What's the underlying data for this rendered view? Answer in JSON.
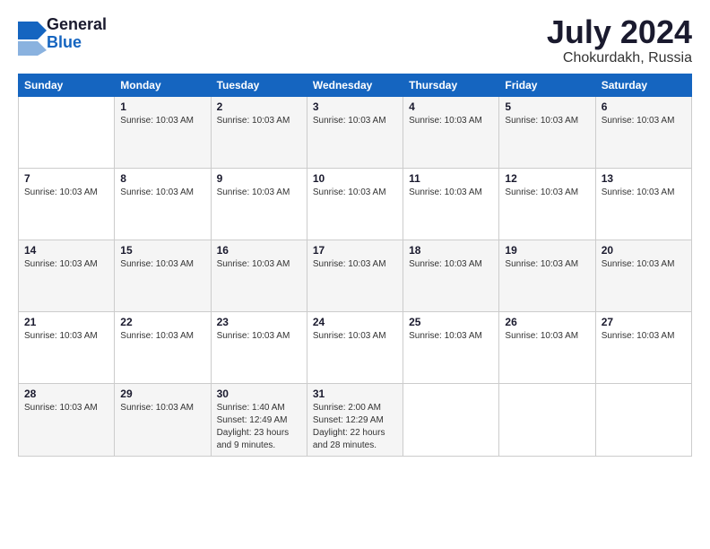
{
  "header": {
    "logo_general": "General",
    "logo_blue": "Blue",
    "month_title": "July 2024",
    "location": "Chokurdakh, Russia"
  },
  "calendar": {
    "days_of_week": [
      "Sunday",
      "Monday",
      "Tuesday",
      "Wednesday",
      "Thursday",
      "Friday",
      "Saturday"
    ],
    "weeks": [
      [
        {
          "day": "",
          "info": ""
        },
        {
          "day": "1",
          "info": "Sunrise: 10:03 AM"
        },
        {
          "day": "2",
          "info": "Sunrise: 10:03 AM"
        },
        {
          "day": "3",
          "info": "Sunrise: 10:03 AM"
        },
        {
          "day": "4",
          "info": "Sunrise: 10:03 AM"
        },
        {
          "day": "5",
          "info": "Sunrise: 10:03 AM"
        },
        {
          "day": "6",
          "info": "Sunrise: 10:03 AM"
        }
      ],
      [
        {
          "day": "7",
          "info": "Sunrise: 10:03 AM"
        },
        {
          "day": "8",
          "info": "Sunrise: 10:03 AM"
        },
        {
          "day": "9",
          "info": "Sunrise: 10:03 AM"
        },
        {
          "day": "10",
          "info": "Sunrise: 10:03 AM"
        },
        {
          "day": "11",
          "info": "Sunrise: 10:03 AM"
        },
        {
          "day": "12",
          "info": "Sunrise: 10:03 AM"
        },
        {
          "day": "13",
          "info": "Sunrise: 10:03 AM"
        }
      ],
      [
        {
          "day": "14",
          "info": "Sunrise: 10:03 AM"
        },
        {
          "day": "15",
          "info": "Sunrise: 10:03 AM"
        },
        {
          "day": "16",
          "info": "Sunrise: 10:03 AM"
        },
        {
          "day": "17",
          "info": "Sunrise: 10:03 AM"
        },
        {
          "day": "18",
          "info": "Sunrise: 10:03 AM"
        },
        {
          "day": "19",
          "info": "Sunrise: 10:03 AM"
        },
        {
          "day": "20",
          "info": "Sunrise: 10:03 AM"
        }
      ],
      [
        {
          "day": "21",
          "info": "Sunrise: 10:03 AM"
        },
        {
          "day": "22",
          "info": "Sunrise: 10:03 AM"
        },
        {
          "day": "23",
          "info": "Sunrise: 10:03 AM"
        },
        {
          "day": "24",
          "info": "Sunrise: 10:03 AM"
        },
        {
          "day": "25",
          "info": "Sunrise: 10:03 AM"
        },
        {
          "day": "26",
          "info": "Sunrise: 10:03 AM"
        },
        {
          "day": "27",
          "info": "Sunrise: 10:03 AM"
        }
      ],
      [
        {
          "day": "28",
          "info": "Sunrise: 10:03 AM"
        },
        {
          "day": "29",
          "info": "Sunrise: 10:03 AM"
        },
        {
          "day": "30",
          "info": "Sunrise: 1:40 AM\nSunset: 12:49 AM\nDaylight: 23 hours and 9 minutes."
        },
        {
          "day": "31",
          "info": "Sunrise: 2:00 AM\nSunset: 12:29 AM\nDaylight: 22 hours and 28 minutes."
        },
        {
          "day": "",
          "info": ""
        },
        {
          "day": "",
          "info": ""
        },
        {
          "day": "",
          "info": ""
        }
      ]
    ]
  }
}
